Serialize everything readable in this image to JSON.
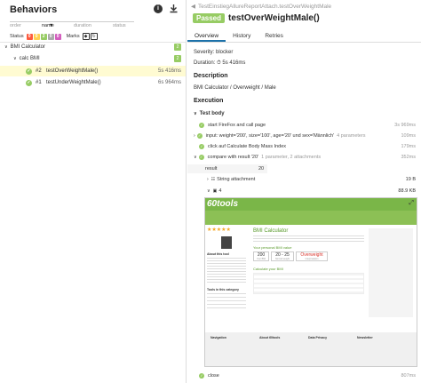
{
  "tree": {
    "title": "Behaviors",
    "filter_placeholder": "",
    "columns": [
      "order",
      "name",
      "duration",
      "status"
    ],
    "status_label": "Status",
    "status_counts": [
      {
        "value": "0",
        "color": "#fd5a3e"
      },
      {
        "value": "0",
        "color": "#ffd050"
      },
      {
        "value": "2",
        "color": "#97cc64"
      },
      {
        "value": "0",
        "color": "#aaaaaa"
      },
      {
        "value": "0",
        "color": "#d35ebe"
      }
    ],
    "marks_label": "Marks",
    "groups": [
      {
        "label": "BMI Calculator",
        "count": "2"
      },
      {
        "label": "calc BMI",
        "count": "2"
      }
    ],
    "tests": [
      {
        "order": "#2",
        "name": "testOverWeightMale()",
        "duration": "5s 416ms"
      },
      {
        "order": "#1",
        "name": "testUnderWeightMale()",
        "duration": "6s 964ms"
      }
    ]
  },
  "detail": {
    "breadcrumb": "TestEinstiegAllureReportAttach.testOverWeightMale",
    "status": "Passed",
    "test_name": "testOverWeightMale()",
    "tabs": [
      "Overview",
      "History",
      "Retries"
    ],
    "severity": "Severity: blocker",
    "duration": "Duration: ⏱ 5s 416ms",
    "description_heading": "Description",
    "description_text": "BMI Calculator / Overweight / Male",
    "execution_heading": "Execution",
    "test_body": "Test body",
    "steps": [
      {
        "text": "start FireFox and call page",
        "meta": "",
        "dur": "3s 969ms"
      },
      {
        "text": "input: weight='200', size='100', age='20' und sex='Männlich'",
        "meta": "4 parameters",
        "dur": "109ms"
      },
      {
        "text": "click auf Calculate Body Mass Index",
        "meta": "",
        "dur": "179ms"
      },
      {
        "text": "compare with result '20'",
        "meta": "1 parameter, 2 attachments",
        "dur": "352ms"
      }
    ],
    "param": {
      "name": "result",
      "value": "20"
    },
    "attachments": [
      {
        "name": "String attachment",
        "size": "19 B"
      },
      {
        "name": "4",
        "size": "88.9 KB"
      }
    ],
    "last_step": {
      "text": "close",
      "dur": "807ms"
    }
  },
  "screenshot": {
    "logo": "60tools",
    "page_title": "BMI Calculator",
    "result_heading": "Your personal BMI value",
    "results": [
      "200",
      "20 - 25",
      "Overweight"
    ],
    "result_labels": [
      "Your BMI",
      "Normal weight",
      "Interpretation"
    ],
    "calc_heading": "Calculate your BMI",
    "about_heading": "About this tool",
    "tools_heading": "Tools in this category",
    "footer": [
      "Navigation",
      "About 60tools",
      "Data Privacy",
      "Newsletter"
    ]
  }
}
